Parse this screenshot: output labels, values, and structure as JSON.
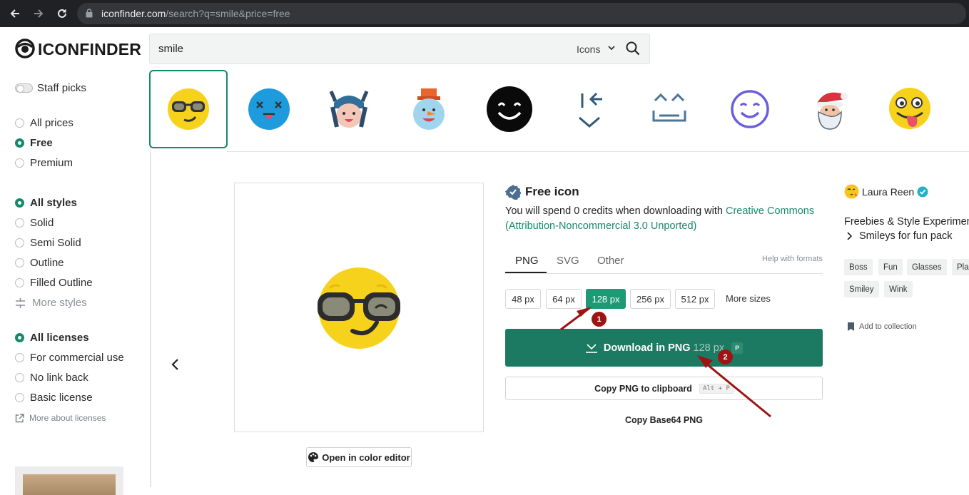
{
  "browser": {
    "url_host": "iconfinder.com",
    "url_path": "/search?q=smile&price=free"
  },
  "header": {
    "logo_text": "ICONFINDER",
    "search_value": "smile",
    "search_type": "Icons"
  },
  "sidebar": {
    "staff_picks": "Staff picks",
    "prices": [
      "All prices",
      "Free",
      "Premium"
    ],
    "styles": [
      "All styles",
      "Solid",
      "Semi Solid",
      "Outline",
      "Filled Outline"
    ],
    "more_styles": "More styles",
    "licenses": [
      "All licenses",
      "For commercial use",
      "No link back",
      "Basic license"
    ],
    "more_licenses": "More about licenses"
  },
  "strip_icons": [
    "sunglasses-smiley-icon",
    "dizzy-face-icon",
    "viking-girl-icon",
    "snowman-icon",
    "black-smile-icon",
    "wink-arrows-icon",
    "happy-eyes-icon",
    "purple-smile-icon",
    "santa-icon",
    "tongue-out-icon"
  ],
  "detail": {
    "title": "Free icon",
    "credits_text": "You will spend 0 credits when downloading with ",
    "license_link": "Creative Commons (Attribution-Noncommercial 3.0 Unported)",
    "tabs": [
      "PNG",
      "SVG",
      "Other"
    ],
    "help_formats": "Help with formats",
    "sizes": [
      "48 px",
      "64 px",
      "128 px",
      "256 px",
      "512 px"
    ],
    "selected_size": "128 px",
    "more_sizes": "More sizes",
    "download_label": "Download in PNG",
    "download_size": "128 px",
    "download_key": "P",
    "copy_label": "Copy PNG to clipboard",
    "copy_key": "Alt + P",
    "base64_label": "Copy Base64 PNG",
    "color_editor": "Open in color editor"
  },
  "author": {
    "name": "Laura Reen",
    "pack": "Freebies & Style Experimen",
    "subpack": "Smileys for fun pack",
    "tags": [
      "Boss",
      "Fun",
      "Glasses",
      "Pla",
      "Smiley",
      "Wink"
    ],
    "add_collection": "Add to collection"
  },
  "annotations": {
    "badge1": "1",
    "badge2": "2",
    "color": "#9e1414"
  },
  "colors": {
    "accent": "#17896a",
    "download_bg": "#1b7a61"
  }
}
